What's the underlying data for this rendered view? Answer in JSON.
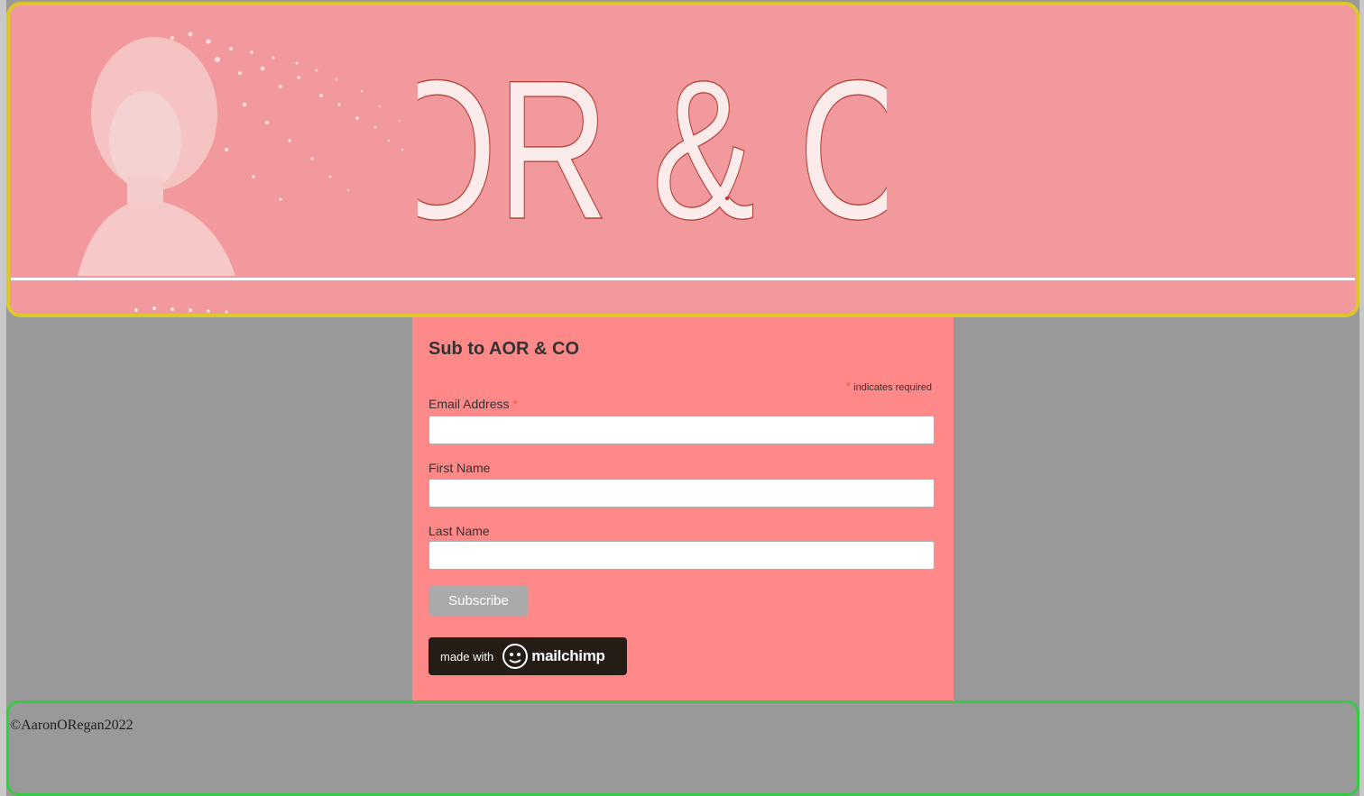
{
  "header": {
    "logo_text": "AOR & CO"
  },
  "form": {
    "title": "Sub to AOR & CO",
    "required_note": "indicates required",
    "required_marker": "*",
    "fields": [
      {
        "label": "Email Address",
        "required": true,
        "value": ""
      },
      {
        "label": "First Name",
        "required": false,
        "value": ""
      },
      {
        "label": "Last Name",
        "required": false,
        "value": ""
      }
    ],
    "subscribe_label": "Subscribe",
    "badge": {
      "made_with": "made with",
      "brand": "mailchimp"
    }
  },
  "footer": {
    "copyright": "©AaronORegan2022"
  },
  "colors": {
    "header_bg": "#f2999d",
    "header_border": "#ddc72a",
    "form_bg": "#ff8888",
    "footer_border": "#33cc44",
    "page_bg": "#999999"
  }
}
